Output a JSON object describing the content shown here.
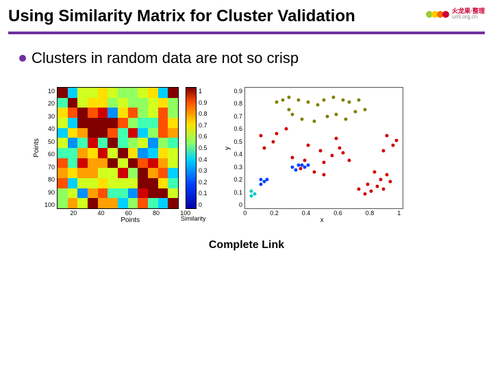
{
  "title": "Using Similarity Matrix for Cluster Validation",
  "logo": {
    "line1": "火龙果·整理",
    "line2": "uml.org.cn"
  },
  "bullet": "Clusters in random data are not so crisp",
  "caption": "Complete Link",
  "chart_data": [
    {
      "type": "heatmap",
      "title": "",
      "xlabel": "Points",
      "ylabel": "Points",
      "xticks": [
        20,
        40,
        60,
        80,
        100
      ],
      "yticks": [
        10,
        20,
        30,
        40,
        50,
        60,
        70,
        80,
        90,
        100
      ],
      "colorbar_label": "Similarity",
      "colorbar_ticks": [
        0,
        0.1,
        0.2,
        0.3,
        0.4,
        0.5,
        0.6,
        0.7,
        0.8,
        0.9,
        1
      ],
      "note": "100x100 similarity matrix; values range 0-1 with noisy block structure (random data, complete-link ordering)"
    },
    {
      "type": "scatter",
      "title": "",
      "xlabel": "x",
      "ylabel": "y",
      "xlim": [
        0,
        1
      ],
      "ylim": [
        0,
        1
      ],
      "xticks": [
        0,
        0.2,
        0.4,
        0.6,
        0.8,
        1
      ],
      "yticks": [
        0,
        0.1,
        0.2,
        0.3,
        0.4,
        0.5,
        0.6,
        0.7,
        0.8,
        0.9
      ],
      "series": [
        {
          "name": "cluster-red",
          "color": "#d00000",
          "points": [
            [
              0.2,
              0.62
            ],
            [
              0.26,
              0.66
            ],
            [
              0.12,
              0.5
            ],
            [
              0.18,
              0.55
            ],
            [
              0.1,
              0.6
            ],
            [
              0.38,
              0.4
            ],
            [
              0.3,
              0.42
            ],
            [
              0.48,
              0.48
            ],
            [
              0.55,
              0.44
            ],
            [
              0.6,
              0.5
            ],
            [
              0.62,
              0.46
            ],
            [
              0.5,
              0.38
            ],
            [
              0.4,
              0.52
            ],
            [
              0.58,
              0.58
            ],
            [
              0.66,
              0.4
            ],
            [
              0.72,
              0.16
            ],
            [
              0.76,
              0.12
            ],
            [
              0.8,
              0.14
            ],
            [
              0.84,
              0.18
            ],
            [
              0.78,
              0.2
            ],
            [
              0.88,
              0.16
            ],
            [
              0.92,
              0.22
            ],
            [
              0.9,
              0.28
            ],
            [
              0.82,
              0.3
            ],
            [
              0.86,
              0.24
            ],
            [
              0.94,
              0.52
            ],
            [
              0.9,
              0.6
            ],
            [
              0.88,
              0.48
            ],
            [
              0.96,
              0.56
            ],
            [
              0.44,
              0.3
            ],
            [
              0.5,
              0.28
            ],
            [
              0.35,
              0.33
            ]
          ]
        },
        {
          "name": "cluster-blue",
          "color": "#0040ff",
          "points": [
            [
              0.3,
              0.34
            ],
            [
              0.34,
              0.36
            ],
            [
              0.36,
              0.36
            ],
            [
              0.38,
              0.34
            ],
            [
              0.32,
              0.32
            ],
            [
              0.1,
              0.24
            ],
            [
              0.12,
              0.22
            ],
            [
              0.14,
              0.24
            ],
            [
              0.1,
              0.2
            ],
            [
              0.4,
              0.36
            ]
          ]
        },
        {
          "name": "cluster-olive",
          "color": "#808000",
          "points": [
            [
              0.2,
              0.88
            ],
            [
              0.24,
              0.9
            ],
            [
              0.28,
              0.92
            ],
            [
              0.34,
              0.9
            ],
            [
              0.4,
              0.88
            ],
            [
              0.46,
              0.86
            ],
            [
              0.5,
              0.9
            ],
            [
              0.56,
              0.92
            ],
            [
              0.62,
              0.9
            ],
            [
              0.66,
              0.88
            ],
            [
              0.72,
              0.9
            ],
            [
              0.76,
              0.82
            ],
            [
              0.7,
              0.8
            ],
            [
              0.64,
              0.74
            ],
            [
              0.58,
              0.78
            ],
            [
              0.52,
              0.76
            ],
            [
              0.44,
              0.72
            ],
            [
              0.36,
              0.74
            ],
            [
              0.3,
              0.78
            ],
            [
              0.28,
              0.82
            ]
          ]
        },
        {
          "name": "cluster-cyan",
          "color": "#00cccc",
          "points": [
            [
              0.04,
              0.14
            ],
            [
              0.06,
              0.12
            ],
            [
              0.04,
              0.1
            ]
          ]
        }
      ]
    }
  ]
}
